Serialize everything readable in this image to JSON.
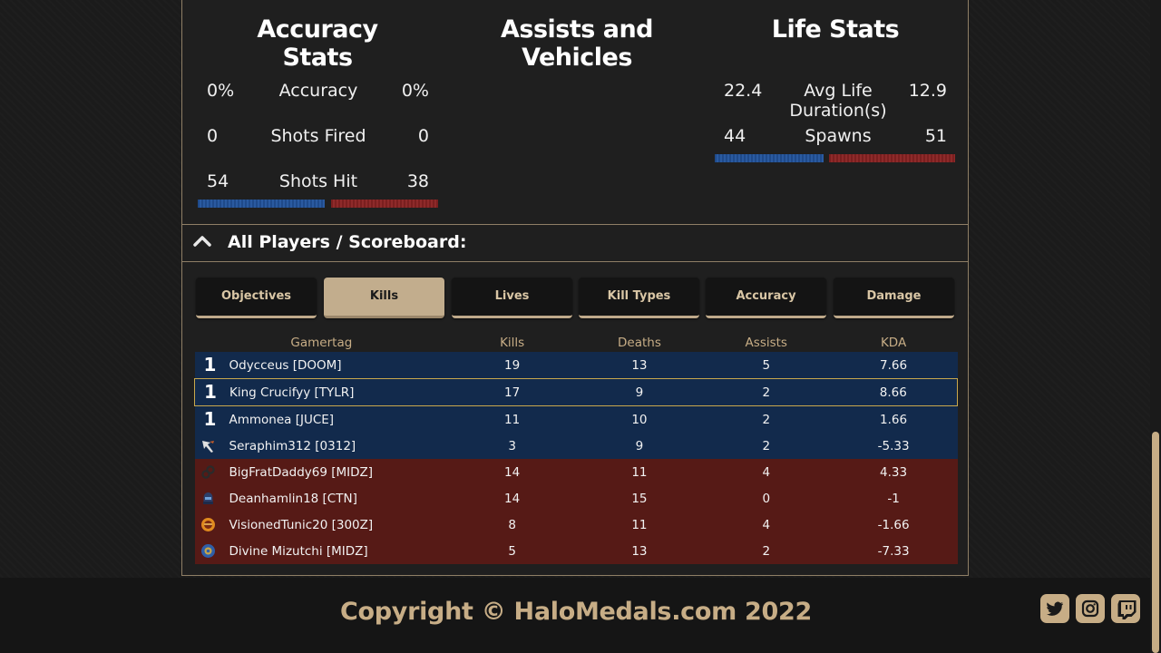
{
  "accuracy_stats": {
    "title": "Accuracy Stats",
    "rows": [
      {
        "left": "0%",
        "label": "Accuracy",
        "right": "0%"
      },
      {
        "left": "0",
        "label": "Shots Fired",
        "right": "0"
      },
      {
        "left": "54",
        "label": "Shots Hit",
        "right": "38"
      }
    ]
  },
  "assists_vehicles": {
    "title": "Assists and Vehicles"
  },
  "life_stats": {
    "title": "Life Stats",
    "rows": [
      {
        "left": "22.4",
        "label": "Avg Life Duration(s)",
        "right": "12.9"
      },
      {
        "left": "44",
        "label": "Spawns",
        "right": "51"
      }
    ]
  },
  "scoreboard": {
    "section_title": "All Players / Scoreboard:",
    "tabs": [
      "Objectives",
      "Kills",
      "Lives",
      "Kill Types",
      "Accuracy",
      "Damage"
    ],
    "active_tab": "Kills",
    "columns": [
      "Gamertag",
      "Kills",
      "Deaths",
      "Assists",
      "KDA"
    ],
    "rows": [
      {
        "team": "blue",
        "emblem": "one",
        "name": "Odycceus [DOOM]",
        "kills": "19",
        "deaths": "13",
        "assists": "5",
        "kda": "7.66"
      },
      {
        "team": "blue",
        "emblem": "one",
        "name": "King Crucifyy [TYLR]",
        "kills": "17",
        "deaths": "9",
        "assists": "2",
        "kda": "8.66"
      },
      {
        "team": "blue",
        "emblem": "one",
        "name": "Ammonea [JUCE]",
        "kills": "11",
        "deaths": "10",
        "assists": "2",
        "kda": "1.66"
      },
      {
        "team": "blue",
        "emblem": "blade",
        "name": "Seraphim312 [0312]",
        "kills": "3",
        "deaths": "9",
        "assists": "2",
        "kda": "-5.33"
      },
      {
        "team": "red",
        "emblem": "rings",
        "name": "BigFratDaddy69 [MIDZ]",
        "kills": "14",
        "deaths": "11",
        "assists": "4",
        "kda": "4.33"
      },
      {
        "team": "red",
        "emblem": "helmet",
        "name": "Deanhamlin18 [CTN]",
        "kills": "14",
        "deaths": "15",
        "assists": "0",
        "kda": "-1"
      },
      {
        "team": "red",
        "emblem": "badge",
        "name": "VisionedTunic20 [300Z]",
        "kills": "8",
        "deaths": "11",
        "assists": "4",
        "kda": "-1.66"
      },
      {
        "team": "red",
        "emblem": "globe",
        "name": "Divine Mizutchi [MIDZ]",
        "kills": "5",
        "deaths": "13",
        "assists": "2",
        "kda": "-7.33"
      }
    ]
  },
  "footer": {
    "copyright": "Copyright © HaloMedals.com 2022",
    "social": [
      "twitter-icon",
      "instagram-icon",
      "twitch-icon"
    ]
  },
  "colors": {
    "accent": "#c7ad86",
    "blue_team": "#122a4c",
    "red_team": "#561a16",
    "selected_border": "#c9a84d"
  }
}
